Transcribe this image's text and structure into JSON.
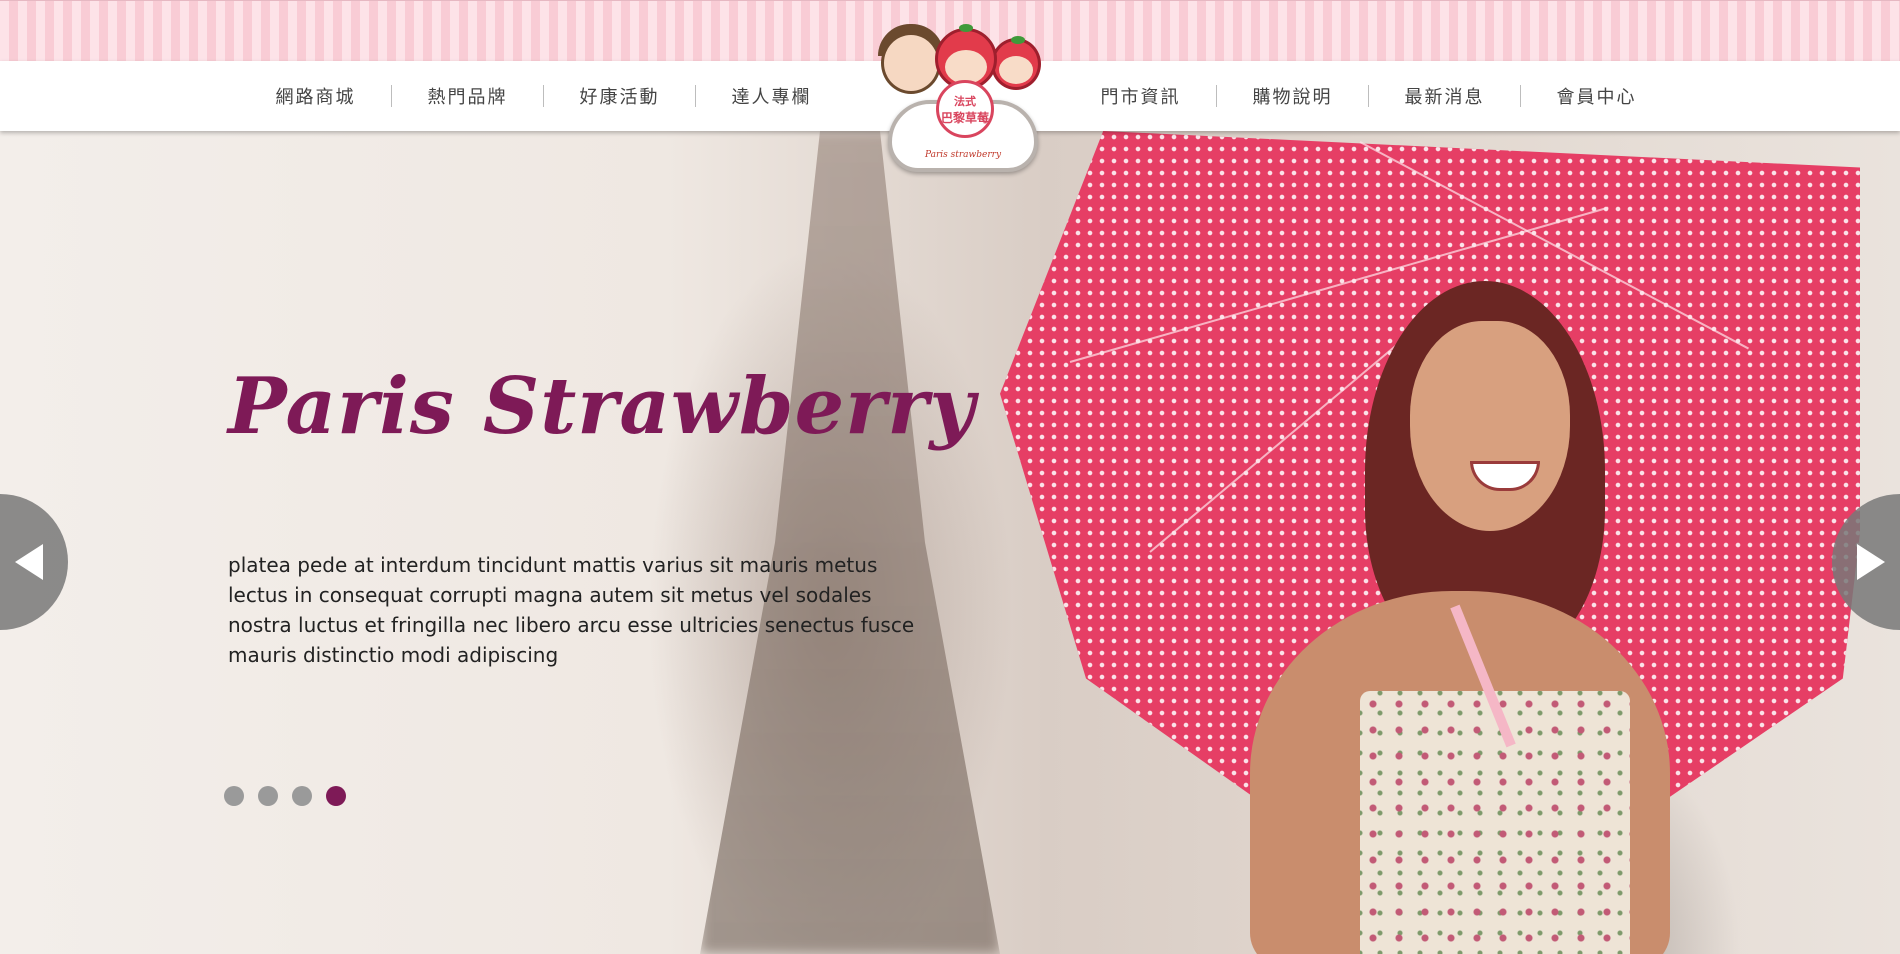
{
  "nav": {
    "left": [
      {
        "label": "網路商城"
      },
      {
        "label": "熱門品牌"
      },
      {
        "label": "好康活動"
      },
      {
        "label": "達人專欄"
      }
    ],
    "right": [
      {
        "label": "門市資訊"
      },
      {
        "label": "購物說明"
      },
      {
        "label": "最新消息"
      },
      {
        "label": "會員中心"
      }
    ]
  },
  "logo": {
    "line1": "法式",
    "line2": "巴黎草莓",
    "subtitle": "Paris strawberry"
  },
  "hero": {
    "title": "Paris Strawberry",
    "body": "platea pede at interdum tincidunt mattis varius sit mauris metus lectus in consequat corrupti magna autem sit metus vel sodales nostra luctus et fringilla nec libero arcu esse ultricies senectus fusce mauris distinctio modi adipiscing",
    "slide_count": 4,
    "active_slide": 4
  },
  "colors": {
    "accent": "#7e1a57",
    "stripe_light": "#fde3e8",
    "stripe_dark": "#f9ccd5",
    "umbrella": "#e63e65",
    "arrow": "#787878"
  },
  "icons": {
    "prev": "chevron-left-icon",
    "next": "chevron-right-icon"
  }
}
